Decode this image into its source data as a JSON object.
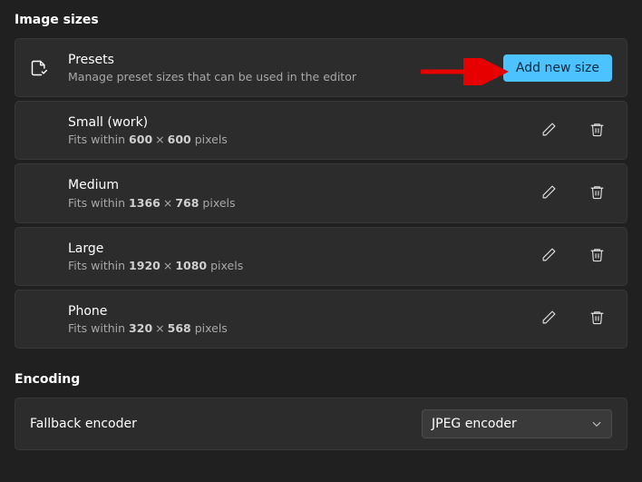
{
  "sections": {
    "image_sizes": {
      "title": "Image sizes",
      "presets_header": {
        "title": "Presets",
        "subtitle": "Manage preset sizes that can be used in the editor",
        "add_button": "Add new size"
      },
      "fits_prefix": "Fits within",
      "fits_suffix": "pixels",
      "items": [
        {
          "name": "Small (work)",
          "w": "600",
          "h": "600"
        },
        {
          "name": "Medium",
          "w": "1366",
          "h": "768"
        },
        {
          "name": "Large",
          "w": "1920",
          "h": "1080"
        },
        {
          "name": "Phone",
          "w": "320",
          "h": "568"
        }
      ]
    },
    "encoding": {
      "title": "Encoding",
      "fallback_label": "Fallback encoder",
      "fallback_value": "JPEG encoder"
    }
  }
}
